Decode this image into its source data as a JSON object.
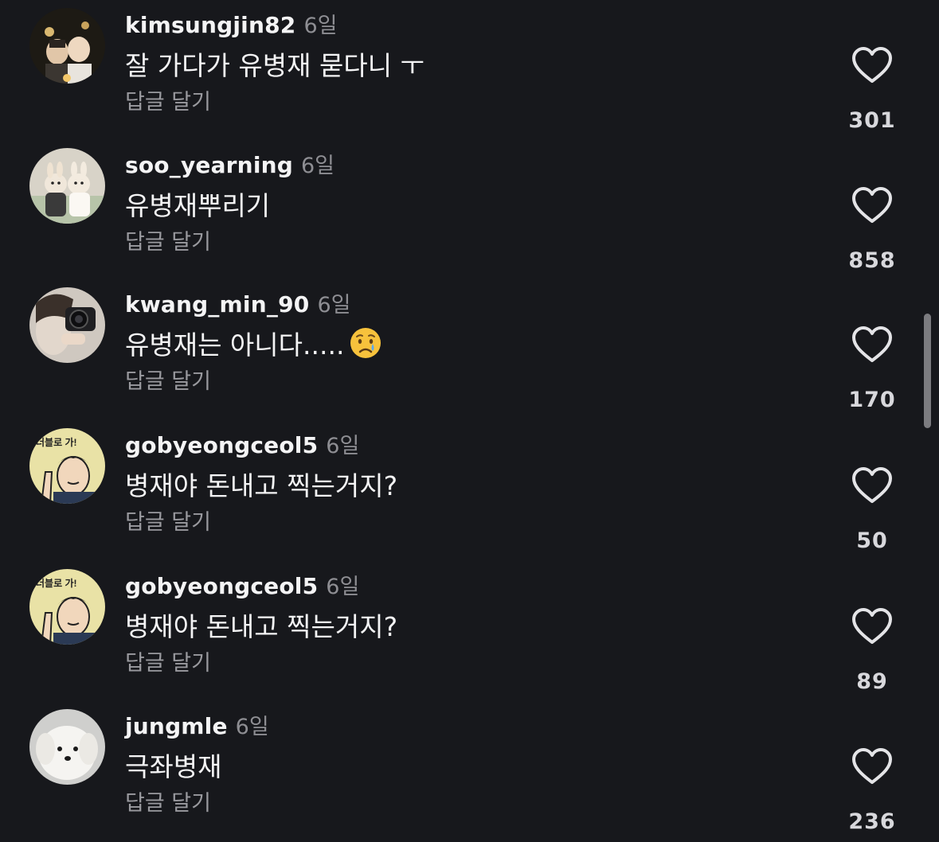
{
  "comments": [
    {
      "username": "kimsungjin82",
      "time": "6일",
      "text": "잘 가다가 유병재 묻다니 ㅜ",
      "reply": "답글 달기",
      "likes": "301",
      "avatar": "couple-photo"
    },
    {
      "username": "soo_yearning",
      "time": "6일",
      "text": "유병재뿌리기",
      "reply": "답글 달기",
      "likes": "858",
      "avatar": "bunny-couple-illustration"
    },
    {
      "username": "kwang_min_90",
      "time": "6일",
      "text": "유병재는 아니다.....",
      "reply": "답글 달기",
      "likes": "170",
      "avatar": "camera-selfie"
    },
    {
      "username": "gobyeongceol5",
      "time": "6일",
      "text": "병재야 돈내고 찍는거지?",
      "reply": "답글 달기",
      "likes": "50",
      "avatar": "cartoon-man",
      "avatar_text": "더블로 가!"
    },
    {
      "username": "gobyeongceol5",
      "time": "6일",
      "text": "병재야 돈내고 찍는거지?",
      "reply": "답글 달기",
      "likes": "89",
      "avatar": "cartoon-man",
      "avatar_text": "더블로 가!"
    },
    {
      "username": "jungmle",
      "time": "6일",
      "text": "극좌병재",
      "reply": "답글 달기",
      "likes": "236",
      "avatar": "white-dog"
    }
  ],
  "icons": {
    "like": "heart-outline-icon",
    "emoji": "crying-face-emoji"
  },
  "colors": {
    "background": "#17181c",
    "text": "#f4f4f5",
    "muted": "#8e8e93",
    "avatar_yellow": "#e9e2a6"
  }
}
